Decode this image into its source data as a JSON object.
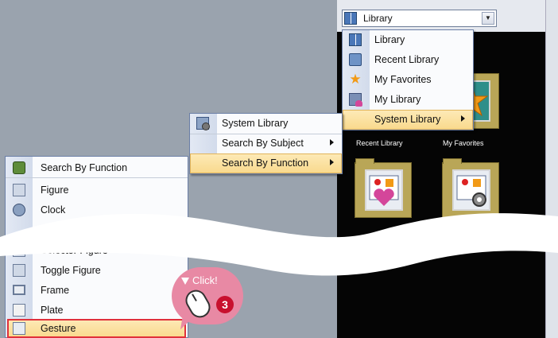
{
  "combo": {
    "value": "Library",
    "icon": "library-icon"
  },
  "library_menu": {
    "items": [
      {
        "label": "Library",
        "icon": "library-icon"
      },
      {
        "label": "Recent Library",
        "icon": "recent-library-icon"
      },
      {
        "label": "My Favorites",
        "icon": "star-icon"
      },
      {
        "label": "My Library",
        "icon": "my-library-icon"
      },
      {
        "label": "System Library",
        "icon": "",
        "submenu": true,
        "highlighted": true
      }
    ]
  },
  "system_menu": {
    "items": [
      {
        "label": "System Library",
        "icon": "system-library-icon"
      },
      {
        "label": "Search By Subject",
        "submenu": true
      },
      {
        "label": "Search By Function",
        "submenu": true,
        "highlighted": true
      }
    ]
  },
  "function_menu": {
    "items_top": [
      {
        "label": "Search By Function",
        "icon": "search-function-icon"
      },
      {
        "label": "Figure",
        "icon": "figure-icon"
      },
      {
        "label": "Clock",
        "icon": "clock-icon"
      }
    ],
    "items_bottom": [
      {
        "label": "Selector Figure",
        "icon": "selector-figure-icon"
      },
      {
        "label": "Toggle Figure",
        "icon": "toggle-figure-icon"
      },
      {
        "label": "Frame",
        "icon": "frame-icon"
      },
      {
        "label": "Plate",
        "icon": "plate-icon"
      },
      {
        "label": "Gesture",
        "icon": "gesture-icon",
        "selected": true
      }
    ]
  },
  "tiles": [
    {
      "label": "Recent Library"
    },
    {
      "label": "My Favorites"
    }
  ],
  "callout": {
    "text": "Click!",
    "step": "3"
  },
  "colors": {
    "menu_highlight": "#f9d98c",
    "selection_outline": "#e0313c",
    "callout_pink": "#e889a4",
    "step_badge": "#c8102e"
  }
}
